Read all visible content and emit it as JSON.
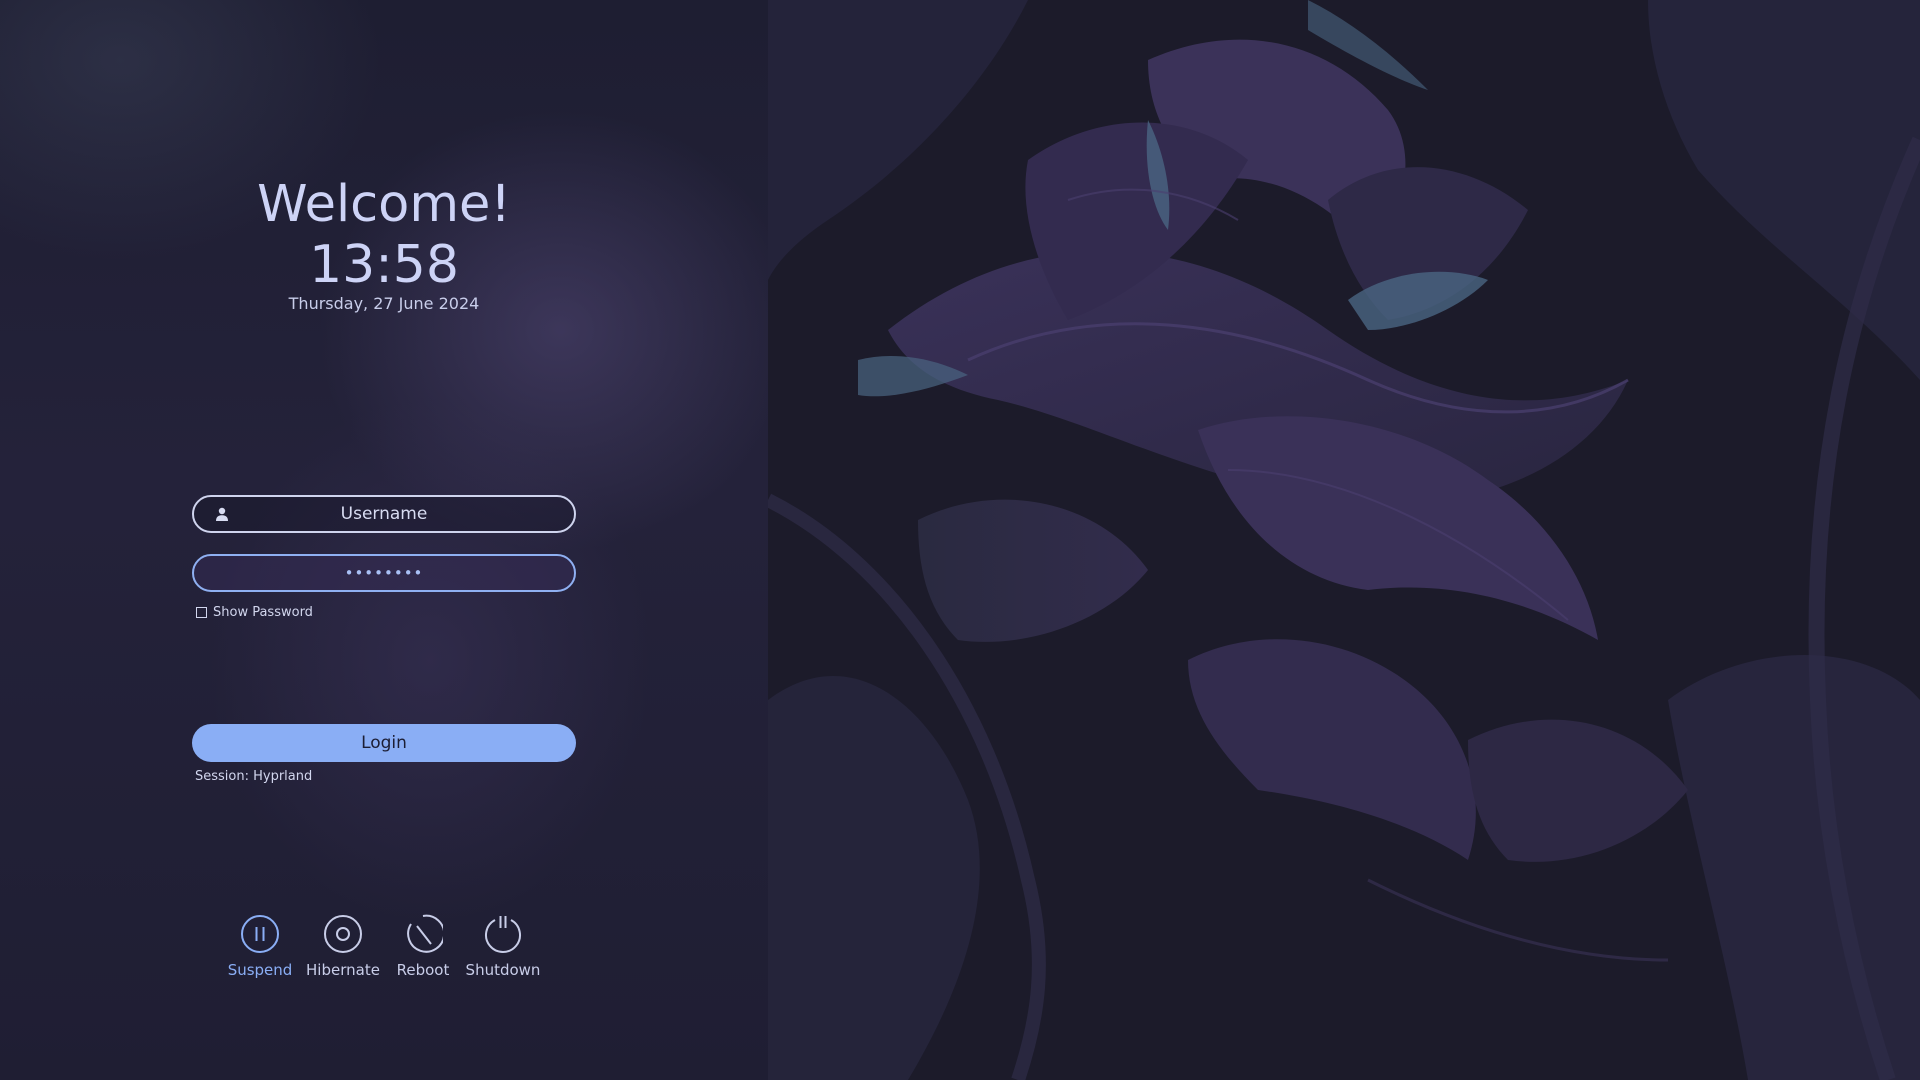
{
  "greeting": {
    "welcome": "Welcome!",
    "time": "13:58",
    "date": "Thursday, 27 June 2024"
  },
  "login_form": {
    "username_value": "Username",
    "password_value": "••••••••",
    "show_password_label": "Show Password",
    "show_password_checked": false,
    "login_label": "Login",
    "session_text": "Session: Hyprland"
  },
  "power": {
    "suspend": {
      "label": "Suspend",
      "icon": "pause-circle-icon"
    },
    "hibernate": {
      "label": "Hibernate",
      "icon": "ring-circle-icon"
    },
    "reboot": {
      "label": "Reboot",
      "icon": "reboot-icon"
    },
    "shutdown": {
      "label": "Shutdown",
      "icon": "power-icon"
    }
  },
  "colors": {
    "accent": "#8aaef5",
    "panel_bg": "#1e1e32",
    "text": "#cdd3f6",
    "wallpaper_leaf": "#3a3256"
  }
}
